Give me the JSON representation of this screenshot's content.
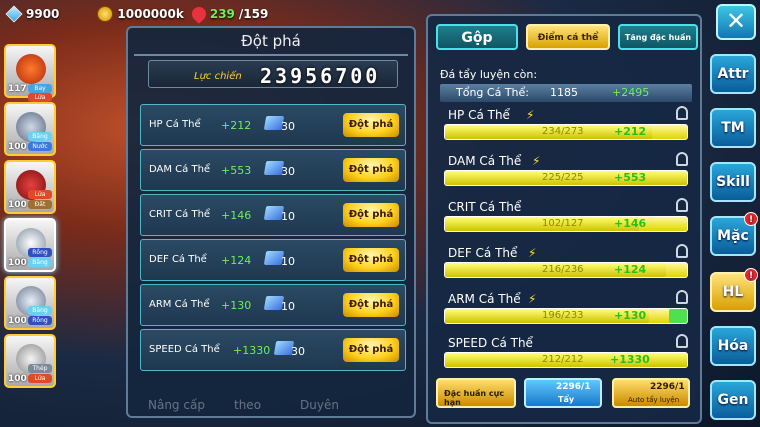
{
  "topbar": {
    "gems": "9900",
    "gold": "1000000k",
    "stamina": "239",
    "stamina_max": "/159"
  },
  "team": [
    {
      "level": "117",
      "tags": [
        "Bay",
        "Lửa"
      ]
    },
    {
      "level": "100",
      "tags": [
        "Băng",
        "Nước"
      ]
    },
    {
      "level": "100",
      "tags": [
        "Lửa",
        "Đất"
      ]
    },
    {
      "level": "100",
      "tags": [
        "Rồng",
        "Băng"
      ]
    },
    {
      "level": "100",
      "tags": [
        "Băng",
        "Rồng"
      ]
    },
    {
      "level": "100",
      "tags": [
        "Thép",
        "Lửa"
      ]
    }
  ],
  "left_panel": {
    "title": "Đột phá",
    "cp_label": "Lực chiến",
    "cp_value": "23956700",
    "rows": [
      {
        "name": "HP Cá Thể",
        "bonus": "+212",
        "cost": "30",
        "button": "Đột phá"
      },
      {
        "name": "DAM Cá Thể",
        "bonus": "+553",
        "cost": "30",
        "button": "Đột phá"
      },
      {
        "name": "CRIT Cá Thể",
        "bonus": "+146",
        "cost": "10",
        "button": "Đột phá"
      },
      {
        "name": "DEF Cá Thể",
        "bonus": "+124",
        "cost": "10",
        "button": "Đột phá"
      },
      {
        "name": "ARM Cá Thể",
        "bonus": "+130",
        "cost": "10",
        "button": "Đột phá"
      },
      {
        "name": "SPEED Cá Thể",
        "bonus": "+1330",
        "cost": "30",
        "button": "Đột phá"
      }
    ],
    "bottom_nav": [
      "Nâng cấp",
      "theo",
      "Duyên"
    ]
  },
  "right_panel": {
    "tabs": [
      "Gộp",
      "Điểm cá thể",
      "Tăng đặc huấn"
    ],
    "remaining_label": "Đá tẩy luyện còn:",
    "total_label": "Tổng Cá Thể:",
    "total_value": "1185",
    "total_add": "+2495",
    "stats": [
      {
        "name": "HP Cá Thể",
        "value": "234/273",
        "add": "+212",
        "fill": 0.857
      },
      {
        "name": "DAM Cá Thể",
        "value": "225/225",
        "add": "+553",
        "fill": 1.0
      },
      {
        "name": "CRIT Cá Thể",
        "value": "102/127",
        "add": "+146",
        "fill": 0.803
      },
      {
        "name": "DEF Cá Thể",
        "value": "216/236",
        "add": "+124",
        "fill": 0.915
      },
      {
        "name": "ARM Cá Thể",
        "value": "196/233",
        "add": "+130",
        "fill": 0.841
      },
      {
        "name": "SPEED Cá Thể",
        "value": "212/212",
        "add": "+1330",
        "fill": 1.0
      }
    ],
    "buttons": {
      "special": "Đặc huấn cực hạn",
      "wash_count": "2296/1",
      "wash": "Tẩy",
      "auto_count": "2296/1",
      "auto": "Auto tẩy luyện"
    }
  },
  "side_menu": [
    "Attr",
    "TM",
    "Skill",
    "Mặc",
    "HL",
    "Hóa",
    "Gen"
  ],
  "close_symbol": "✕"
}
